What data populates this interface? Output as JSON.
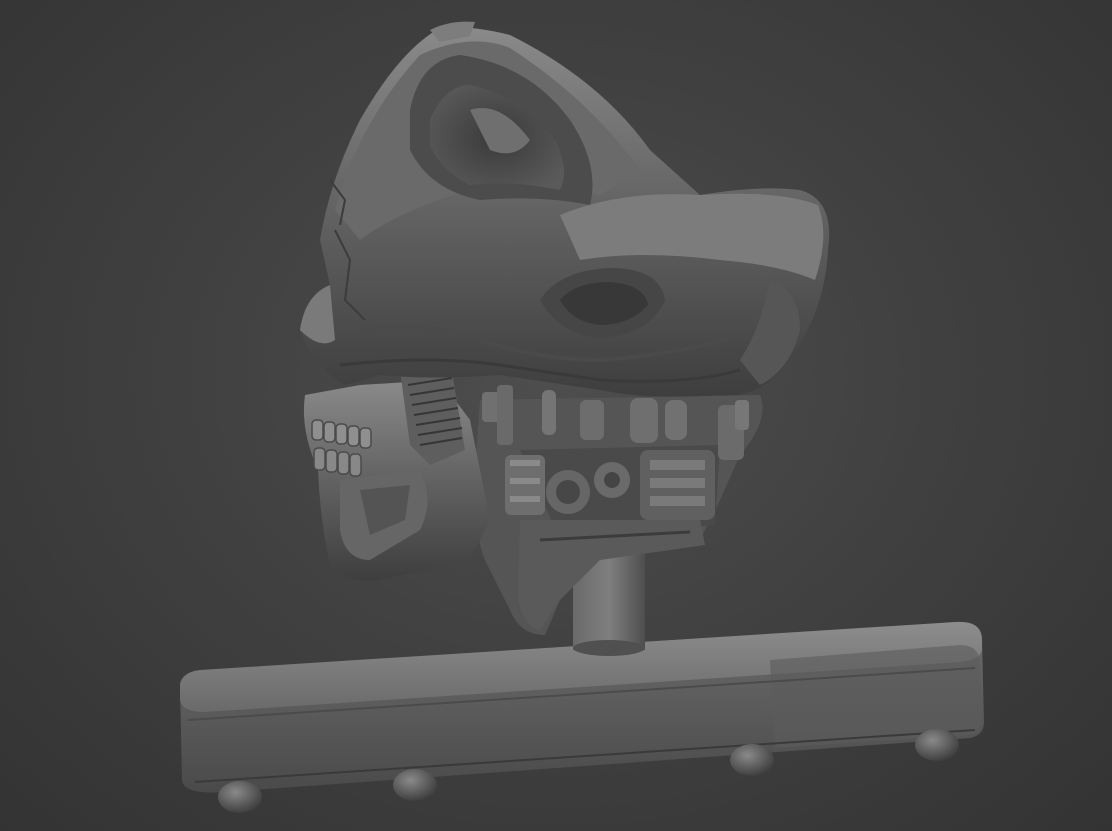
{
  "scene": {
    "subject": "sculpt-render",
    "colors": {
      "background_center": "#4e4e4e",
      "background_edge": "#333333",
      "clay_light": "#8c8c8c",
      "clay_mid": "#5f5f5f",
      "clay_dark": "#2a2a2a"
    }
  }
}
